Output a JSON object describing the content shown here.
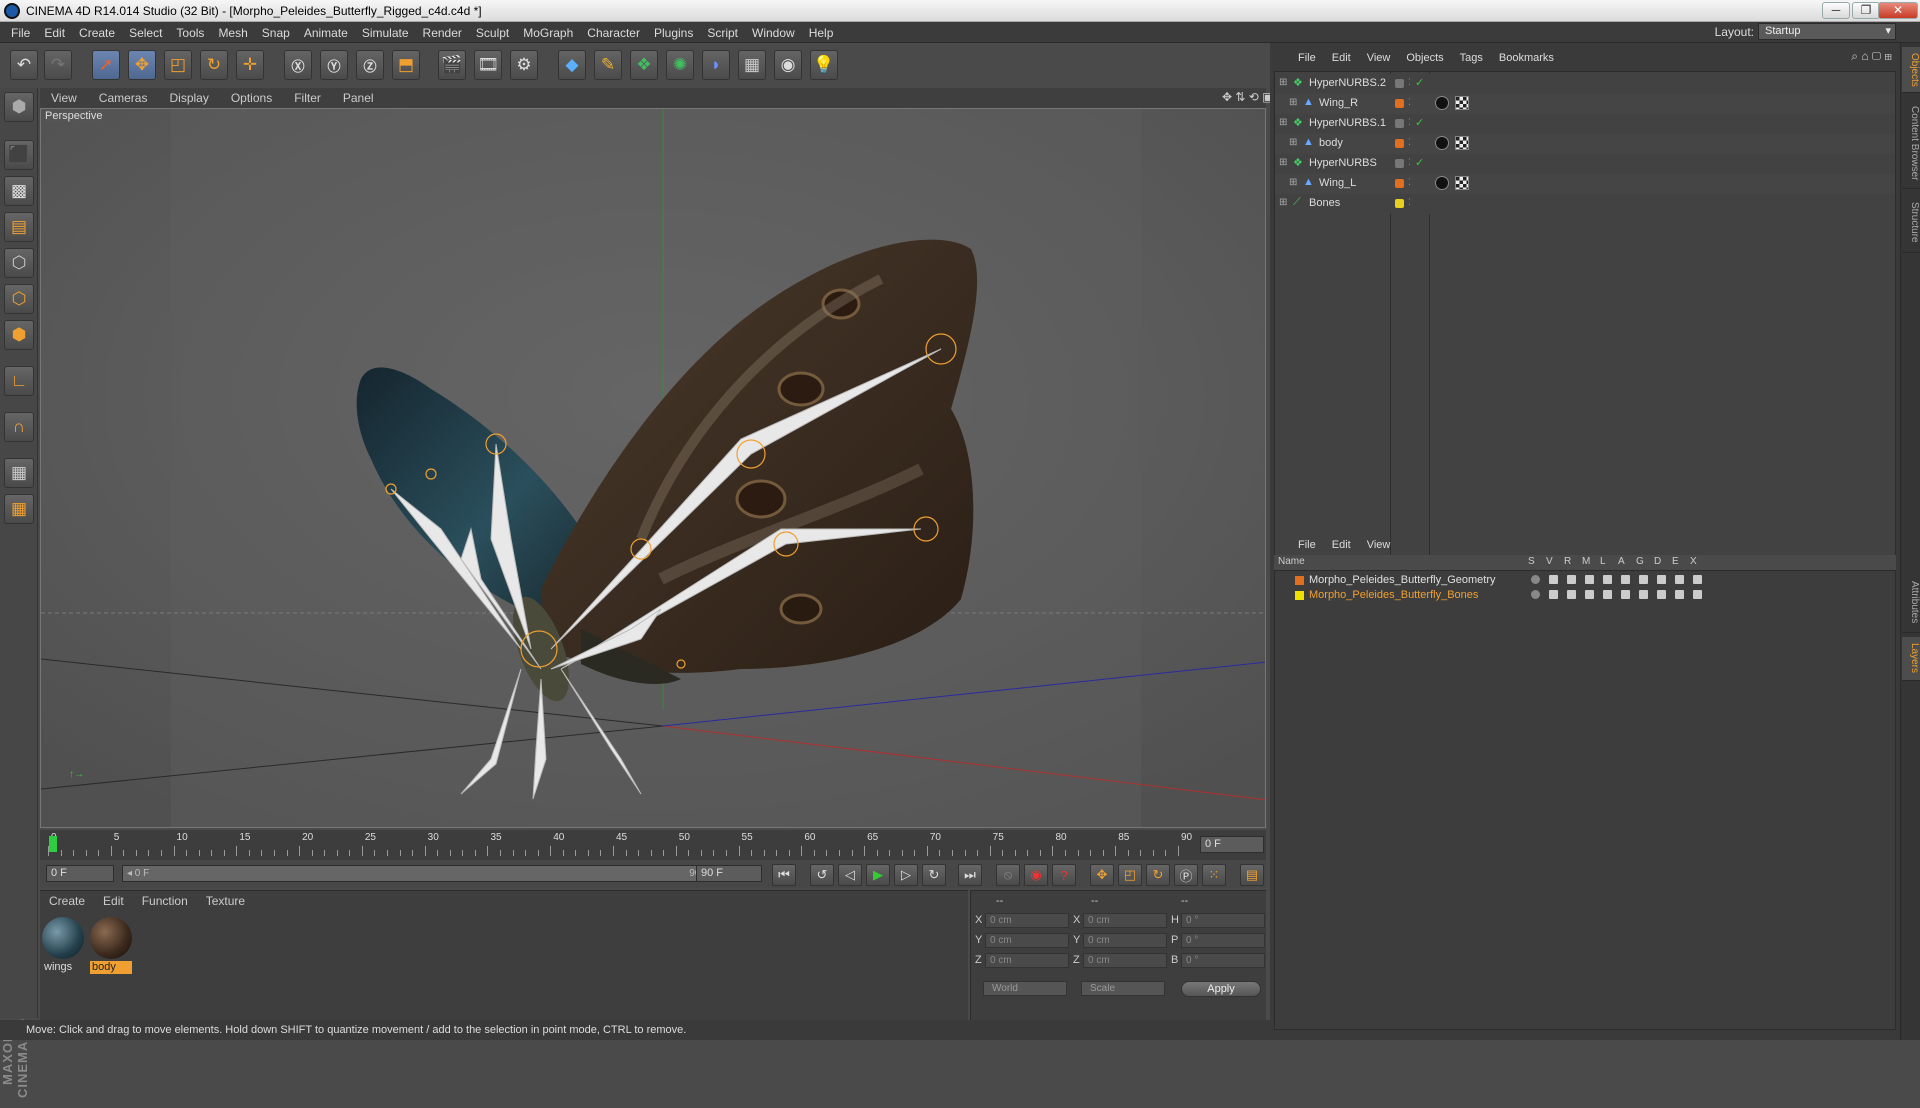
{
  "window": {
    "title": "CINEMA 4D R14.014 Studio (32 Bit) - [Morpho_Peleides_Butterfly_Rigged_c4d.c4d *]",
    "minimize": "─",
    "maximize": "❐",
    "close": "✕"
  },
  "menubar": {
    "items": [
      "File",
      "Edit",
      "Create",
      "Select",
      "Tools",
      "Mesh",
      "Snap",
      "Animate",
      "Simulate",
      "Render",
      "Sculpt",
      "MoGraph",
      "Character",
      "Plugins",
      "Script",
      "Window",
      "Help"
    ],
    "layout_label": "Layout:",
    "layout_value": "Startup"
  },
  "viewport": {
    "menu": [
      "View",
      "Cameras",
      "Display",
      "Options",
      "Filter",
      "Panel"
    ],
    "label": "Perspective"
  },
  "timeline": {
    "ticks": [
      "0",
      "5",
      "10",
      "15",
      "20",
      "25",
      "30",
      "35",
      "40",
      "45",
      "50",
      "55",
      "60",
      "65",
      "70",
      "75",
      "80",
      "85",
      "90"
    ],
    "current_frame": "0 F"
  },
  "playbar": {
    "start_field": "0 F",
    "range_start": "◂ 0 F",
    "range_end": "90 F ▸",
    "end_field": "90 F"
  },
  "materials": {
    "menu": [
      "Create",
      "Edit",
      "Function",
      "Texture"
    ],
    "items": [
      {
        "name": "wings",
        "selected": false
      },
      {
        "name": "body",
        "selected": true
      }
    ]
  },
  "coordinates": {
    "headers": [
      "--",
      "--",
      "--"
    ],
    "rows": [
      {
        "a": "X",
        "av": "0 cm",
        "b": "X",
        "bv": "0 cm",
        "c": "H",
        "cv": "0 °"
      },
      {
        "a": "Y",
        "av": "0 cm",
        "b": "Y",
        "bv": "0 cm",
        "c": "P",
        "cv": "0 °"
      },
      {
        "a": "Z",
        "av": "0 cm",
        "b": "Z",
        "bv": "0 cm",
        "c": "B",
        "cv": "0 °"
      }
    ],
    "mode1": "World",
    "mode2": "Scale",
    "apply": "Apply"
  },
  "status": "Move: Click and drag to move elements. Hold down SHIFT to quantize movement / add to the selection in point mode, CTRL to remove.",
  "maxon": "MAXON CINEMA 4D",
  "objects": {
    "menu": [
      "File",
      "Edit",
      "View",
      "Objects",
      "Tags",
      "Bookmarks"
    ],
    "rows": [
      {
        "name": "HyperNURBS.2",
        "indent": 0,
        "color": "#777777"
      },
      {
        "name": "Wing_R",
        "indent": 1,
        "color": "#e07020"
      },
      {
        "name": "HyperNURBS.1",
        "indent": 0,
        "color": "#777777"
      },
      {
        "name": "body",
        "indent": 1,
        "color": "#e07020"
      },
      {
        "name": "HyperNURBS",
        "indent": 0,
        "color": "#777777"
      },
      {
        "name": "Wing_L",
        "indent": 1,
        "color": "#e07020"
      },
      {
        "name": "Bones",
        "indent": 0,
        "color": "#e8d020"
      }
    ]
  },
  "layers": {
    "menu": [
      "File",
      "Edit",
      "View"
    ],
    "header_name": "Name",
    "columns": [
      "S",
      "V",
      "R",
      "M",
      "L",
      "A",
      "G",
      "D",
      "E",
      "X"
    ],
    "rows": [
      {
        "name": "Morpho_Peleides_Butterfly_Geometry",
        "color": "#e07020",
        "text_color": "#e0e0e0"
      },
      {
        "name": "Morpho_Peleides_Butterfly_Bones",
        "color": "#f0e000",
        "text_color": "#f0a030"
      }
    ]
  },
  "side_tabs": [
    "Objects",
    "Content Browser",
    "Structure",
    "Attributes",
    "Layers"
  ]
}
